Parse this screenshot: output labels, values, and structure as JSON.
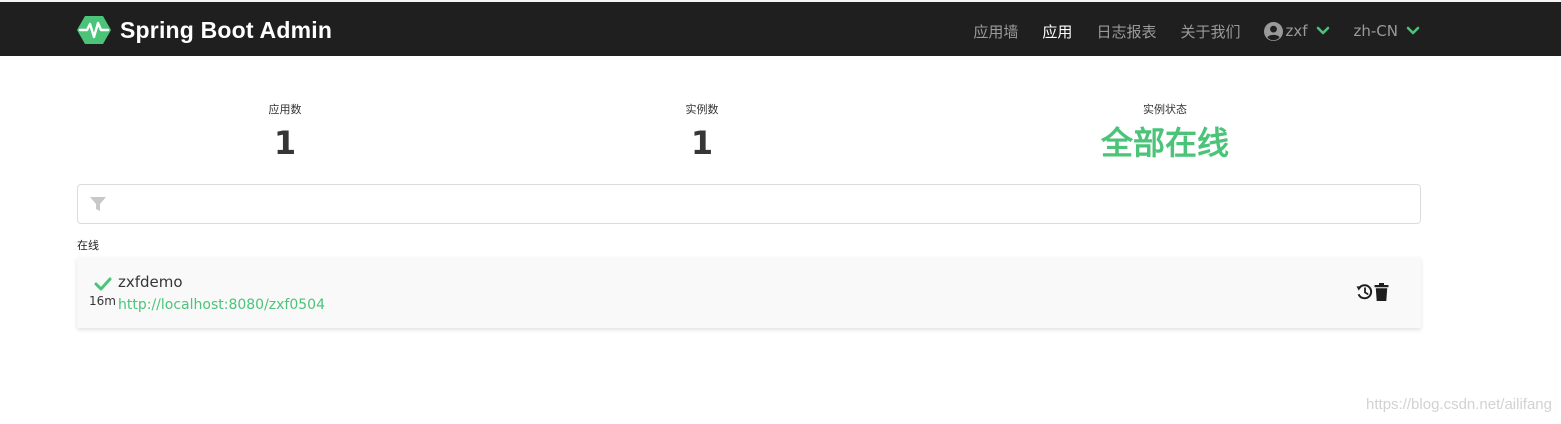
{
  "brand": {
    "title": "Spring Boot Admin",
    "logo_icon": "heartbeat-hexagon-icon"
  },
  "nav": {
    "items": [
      {
        "label": "应用墙",
        "active": false
      },
      {
        "label": "应用",
        "active": true
      },
      {
        "label": "日志报表",
        "active": false
      },
      {
        "label": "关于我们",
        "active": false
      }
    ],
    "user": {
      "name": "zxf",
      "icon": "user-circle-icon"
    },
    "language": {
      "value": "zh-CN"
    }
  },
  "stats": {
    "applications": {
      "label": "应用数",
      "value": "1"
    },
    "instances": {
      "label": "实例数",
      "value": "1"
    },
    "status": {
      "label": "实例状态",
      "value": "全部在线"
    }
  },
  "filter": {
    "placeholder": "",
    "value": "",
    "icon": "filter-icon"
  },
  "groups": [
    {
      "label": "在线",
      "apps": [
        {
          "name": "zxfdemo",
          "uptime": "16m",
          "url": "http://localhost:8080/zxf0504",
          "status_icon": "check-icon"
        }
      ]
    }
  ],
  "watermark": "https://blog.csdn.net/ailifang",
  "colors": {
    "navbar_bg": "#1f1f1f",
    "accent": "#4bc479",
    "card_bg": "#f9f9f9"
  }
}
